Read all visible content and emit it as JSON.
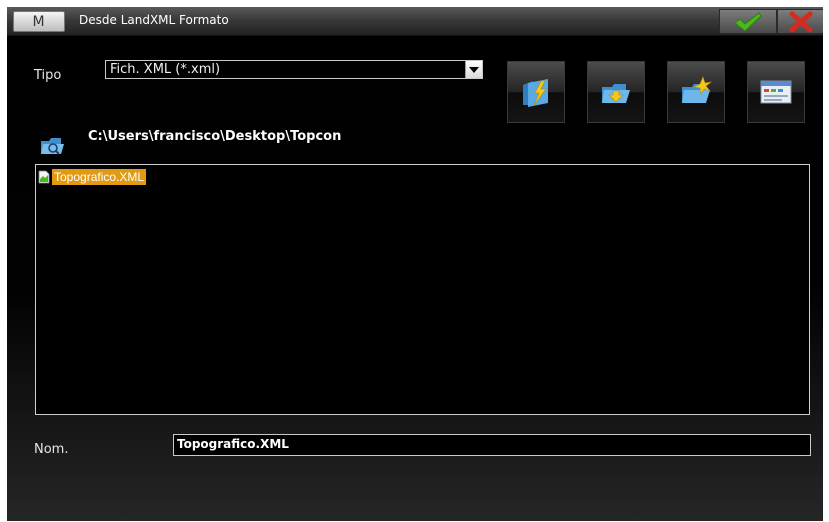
{
  "titlebar": {
    "menu_label": "M",
    "title": "Desde LandXML Formato",
    "ok_icon": "checkmark-icon",
    "cancel_icon": "close-icon",
    "ok_color": "#4bb91e",
    "cancel_color": "#d72a1e"
  },
  "type_row": {
    "label": "Tipo",
    "selected": "Fich. XML (*.xml)"
  },
  "toolbar": {
    "buttons": [
      {
        "name": "quick-open-button",
        "icon": "folder-lightning-icon"
      },
      {
        "name": "folder-up-button",
        "icon": "folder-arrow-icon"
      },
      {
        "name": "new-folder-button",
        "icon": "new-folder-icon"
      },
      {
        "name": "view-options-button",
        "icon": "window-list-icon"
      }
    ]
  },
  "path": {
    "icon": "folder-search-icon",
    "text": "C:\\Users\\francisco\\Desktop\\Topcon"
  },
  "files": [
    {
      "name": "Topografico.XML",
      "selected": true
    }
  ],
  "name_row": {
    "label": "Nom.",
    "value": "Topografico.XML"
  },
  "colors": {
    "selection": "#e29a12",
    "icon_blue": "#3f8fcc",
    "icon_yellow": "#f1c81b"
  }
}
